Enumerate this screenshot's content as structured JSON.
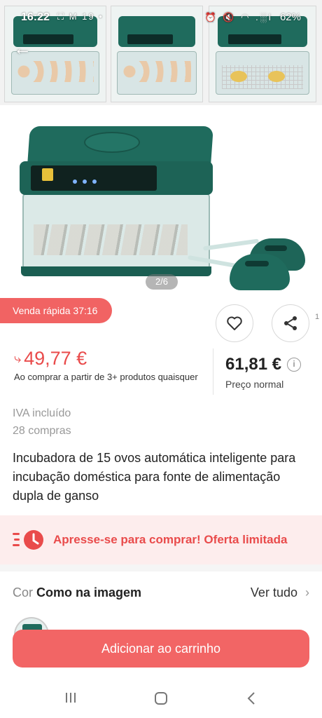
{
  "status_bar": {
    "time": "16:22",
    "left_icons": "⛶ M 19 •",
    "right_icons": "⏰ 🔇 ◠ .░l",
    "battery": "62%"
  },
  "gallery": {
    "counter": "2/6",
    "thumbnails": [
      "thumb-1",
      "thumb-2",
      "thumb-3"
    ]
  },
  "flash_sale": {
    "label": "Venda rápida 37:16"
  },
  "side_number": "1",
  "price": {
    "sale": "49,77 €",
    "sale_note": "Ao comprar a partir de 3+ produtos quaisquer",
    "normal": "61,81 €",
    "normal_label": "Preço normal"
  },
  "meta": {
    "vat": "IVA incluído",
    "purchases": "28 compras"
  },
  "product": {
    "title": "Incubadora de 15 ovos automática inteligente para incubação doméstica para fonte de alimentação dupla de ganso"
  },
  "hurry_banner": {
    "text": "Apresse-se para comprar! Oferta limitada"
  },
  "color": {
    "label": "Cor",
    "value": "Como na imagem",
    "see_all": "Ver tudo"
  },
  "cart_button": "Adicionar ao carrinho",
  "colors": {
    "accent": "#f26565",
    "sale_text": "#e94b4b",
    "banner_bg": "#fdeded",
    "product_green": "#1f6b5d"
  }
}
